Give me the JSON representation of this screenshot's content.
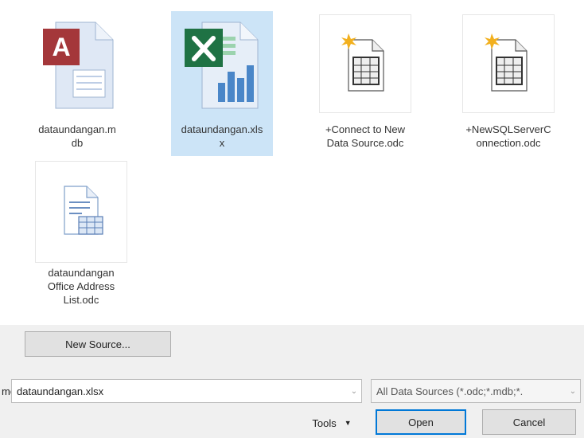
{
  "files": [
    {
      "name_line1": "dataundangan.m",
      "name_line2": "db",
      "name_line3": "",
      "icon": "access-database-icon",
      "selected": false
    },
    {
      "name_line1": "dataundangan.xls",
      "name_line2": "x",
      "name_line3": "",
      "icon": "excel-workbook-icon",
      "selected": true
    },
    {
      "name_line1": "+Connect to New",
      "name_line2": "Data Source.odc",
      "name_line3": "",
      "icon": "odc-connection-icon",
      "selected": false
    },
    {
      "name_line1": "+NewSQLServerC",
      "name_line2": "onnection.odc",
      "name_line3": "",
      "icon": "odc-connection-icon",
      "selected": false
    },
    {
      "name_line1": "dataundangan",
      "name_line2": "Office Address",
      "name_line3": "List.odc",
      "icon": "address-list-icon",
      "selected": false
    }
  ],
  "new_source_label": "New Source...",
  "filename_label": "me:",
  "filename_value": "dataundangan.xlsx",
  "filetype_value": "All Data Sources (*.odc;*.mdb;*.",
  "tools_label": "Tools",
  "open_label": "Open",
  "cancel_label": "Cancel",
  "colors": {
    "selection": "#cce4f7",
    "accent": "#0078d7",
    "panel": "#f0f0f0"
  }
}
